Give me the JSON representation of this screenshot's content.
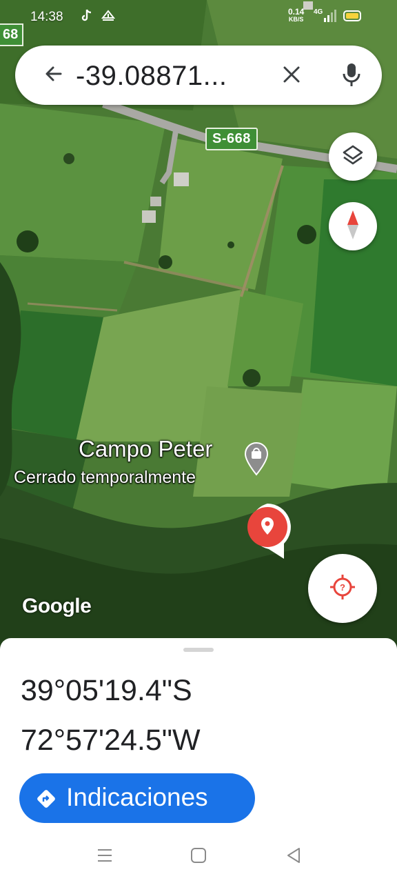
{
  "status_bar": {
    "time": "14:38",
    "speed_value": "0.14",
    "speed_unit": "KB/S",
    "network": "4G"
  },
  "map": {
    "route_label_left": "68",
    "route_label": "S-668",
    "place_name": "Campo Peter",
    "place_status": "Cerrado temporalmente",
    "attribution": "Google"
  },
  "search": {
    "query": "-39.08871..."
  },
  "sheet": {
    "latitude": "39°05'19.4\"S",
    "longitude": "72°57'24.5\"W",
    "directions_label": "Indicaciones"
  },
  "colors": {
    "accent_blue": "#1a73e8",
    "pin_red": "#e8453c",
    "route_green": "#3f8f36"
  },
  "icons": {
    "back": "arrow-left-icon",
    "clear": "close-icon",
    "mic": "microphone-icon",
    "layers": "layers-icon",
    "compass": "compass-icon",
    "location": "my-location-icon",
    "directions": "directions-icon"
  }
}
